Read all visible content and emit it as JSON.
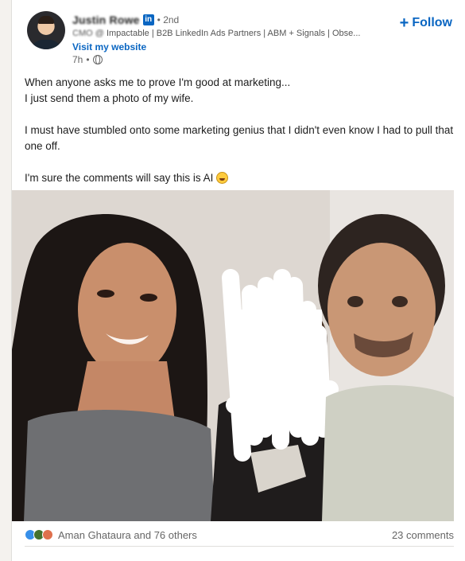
{
  "author": {
    "name": "Justin Rowe",
    "degree": "• 2nd",
    "headline_prefix": "CMO @ ",
    "headline": "Impactable | B2B LinkedIn Ads Partners | ABM + Signals | Obse...",
    "website_label": "Visit my website",
    "time": "7h",
    "badge": "in"
  },
  "follow_label": "Follow",
  "post": {
    "lines": [
      "When anyone asks me to prove I'm good at marketing...",
      "I just send them a photo of my wife.",
      "",
      "I must have stumbled onto some marketing genius that I didn't even know I had to pull that one off.",
      "",
      "I'm sure the comments will say this is AI"
    ]
  },
  "social": {
    "reactions_text": "Aman Ghataura and 76 others",
    "comments_text": "23 comments",
    "reaction_icons": [
      "like-icon",
      "celebrate-icon",
      "love-icon"
    ]
  },
  "colors": {
    "brand": "#0a66c2",
    "like": "#378fe9",
    "celebrate": "#44712e",
    "love": "#df704d"
  }
}
